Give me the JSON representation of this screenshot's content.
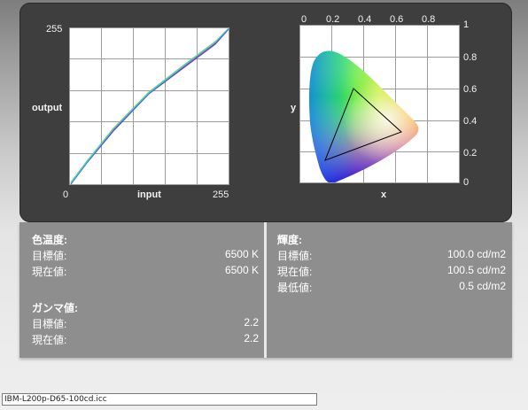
{
  "curve": {
    "y_max_label": "255",
    "y_axis_title": "output",
    "origin_label": "0",
    "x_axis_title": "input",
    "x_max_label": "255"
  },
  "cie": {
    "x_ticks": [
      "0",
      "0.2",
      "0.4",
      "0.6",
      "0.8",
      "1"
    ],
    "y_ticks": [
      "0.8",
      "0.6",
      "0.4",
      "0.2",
      "0"
    ],
    "x_axis_title": "x",
    "y_axis_title": "y"
  },
  "color_temp": {
    "heading": "色温度:",
    "target_label": "目標値:",
    "target_value": "6500 K",
    "current_label": "現在値:",
    "current_value": "6500 K"
  },
  "gamma": {
    "heading": "ガンマ値:",
    "target_label": "目標値:",
    "target_value": "2.2",
    "current_label": "現在値:",
    "current_value": "2.2"
  },
  "luminance": {
    "heading": "輝度:",
    "target_label": "目標値:",
    "target_value": "100.0 cd/m2",
    "current_label": "現在値:",
    "current_value": "100.5 cd/m2",
    "min_label": "最低値:",
    "min_value": "0.5 cd/m2"
  },
  "profile": {
    "filename": "IBM-L200p-D65-100cd.icc"
  }
}
